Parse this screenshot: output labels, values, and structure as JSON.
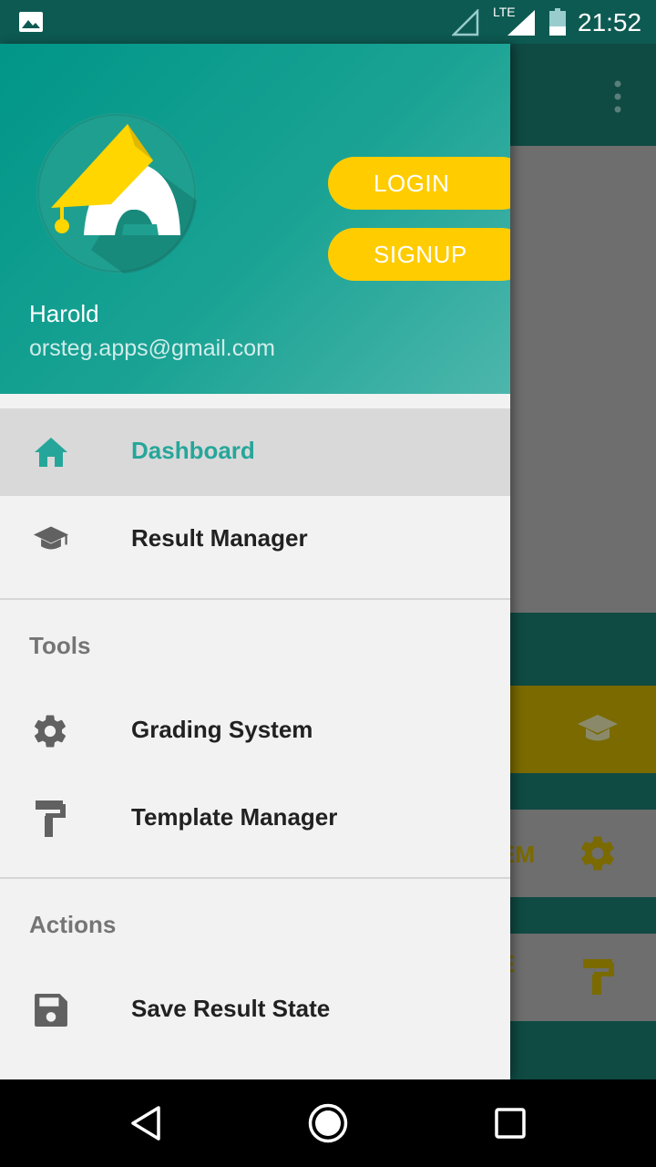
{
  "status_bar": {
    "network_label": "LTE",
    "time": "21:52"
  },
  "drawer": {
    "header": {
      "login_label": "LOGIN",
      "signup_label": "SIGNUP",
      "user_name": "Harold",
      "user_email": "orsteg.apps@gmail.com"
    },
    "items": [
      {
        "label": "Dashboard",
        "icon": "home-icon",
        "active": true
      },
      {
        "label": "Result Manager",
        "icon": "graduation-cap-icon",
        "active": false
      }
    ],
    "sections": [
      {
        "title": "Tools",
        "items": [
          {
            "label": "Grading System",
            "icon": "gear-icon"
          },
          {
            "label": "Template Manager",
            "icon": "paint-roller-icon"
          }
        ]
      },
      {
        "title": "Actions",
        "items": [
          {
            "label": "Save Result State",
            "icon": "save-icon"
          }
        ]
      }
    ]
  },
  "background": {
    "card2_text": "EM",
    "card3_text": "E"
  },
  "colors": {
    "primary": "#009688",
    "accent": "#ffcc00",
    "active_text": "#26a69a"
  }
}
